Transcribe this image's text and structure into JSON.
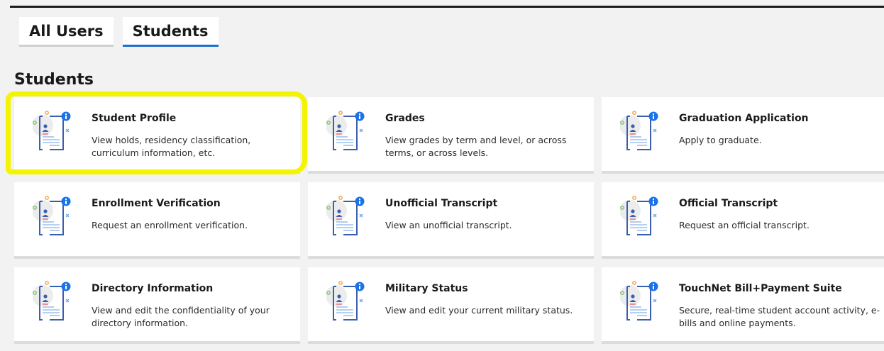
{
  "tabs": [
    {
      "label": "All Users",
      "active": false
    },
    {
      "label": "Students",
      "active": true
    }
  ],
  "section": {
    "title": "Students"
  },
  "cards": [
    {
      "title": "Student Profile",
      "description": "View holds, residency classification, curriculum information, etc.",
      "icon": "profile-document-icon"
    },
    {
      "title": "Grades",
      "description": "View grades by term and level, or across terms, or across levels.",
      "icon": "profile-document-icon"
    },
    {
      "title": "Graduation Application",
      "description": "Apply to graduate.",
      "icon": "profile-document-icon"
    },
    {
      "title": "Enrollment Verification",
      "description": "Request an enrollment verification.",
      "icon": "profile-document-icon"
    },
    {
      "title": "Unofficial Transcript",
      "description": "View an unofficial transcript.",
      "icon": "profile-document-icon"
    },
    {
      "title": "Official Transcript",
      "description": "Request an official transcript.",
      "icon": "profile-document-icon"
    },
    {
      "title": "Directory Information",
      "description": "View and edit the confidentiality of your directory information.",
      "icon": "profile-document-icon"
    },
    {
      "title": "Military Status",
      "description": "View and edit your current military status.",
      "icon": "profile-document-icon"
    },
    {
      "title": "TouchNet Bill+Payment Suite",
      "description": "Secure, real-time student account activity, e-bills and online payments.",
      "icon": "profile-document-icon"
    }
  ],
  "colors": {
    "accent": "#1e6fcc",
    "highlight": "#f4f400",
    "info_badge": "#1a73e8",
    "icon_line": "#3b5fb0"
  },
  "annotation": {
    "highlighted_card": "Student Profile"
  }
}
